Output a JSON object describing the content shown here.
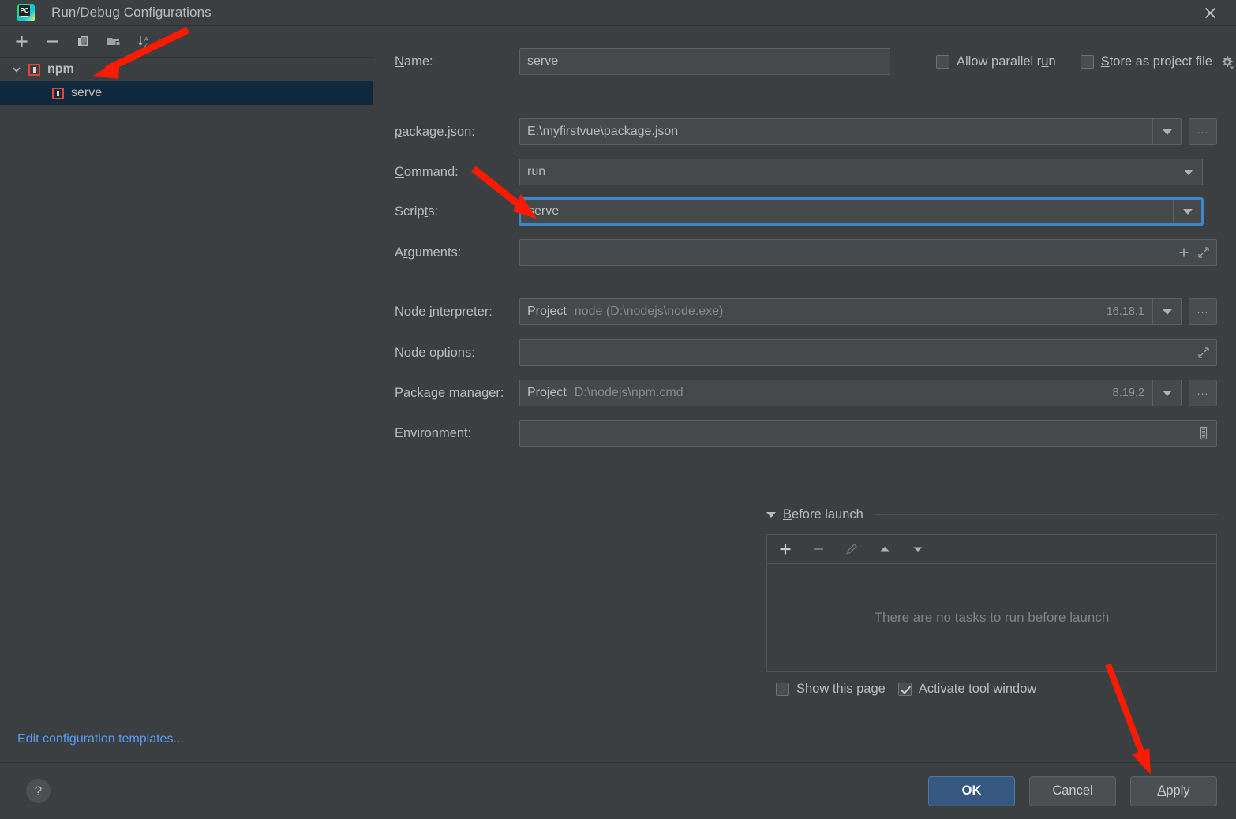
{
  "window": {
    "title": "Run/Debug Configurations",
    "app_icon": "pycharm-logo",
    "close_label": "×"
  },
  "left_panel": {
    "toolbar": [
      {
        "name": "add-configuration-button",
        "glyph": "+"
      },
      {
        "name": "remove-configuration-button",
        "glyph": "−"
      },
      {
        "name": "copy-configuration-button",
        "glyph": "copy-icon"
      },
      {
        "name": "move-into-folder-button",
        "glyph": "folder-icon"
      },
      {
        "name": "sort-configurations-button",
        "glyph": "sort-az-icon"
      }
    ],
    "tree": [
      {
        "name": "tree-group-npm",
        "label": "npm",
        "type": "group",
        "expanded": true,
        "selected": false
      },
      {
        "name": "tree-item-serve",
        "label": "serve",
        "type": "item",
        "selected": true
      }
    ],
    "edit_templates_link": "Edit configuration templates..."
  },
  "form": {
    "name_label": "Name:",
    "name_value": "serve",
    "allow_parallel_run_label": "Allow parallel run",
    "allow_parallel_run_checked": false,
    "store_as_project_file_label": "Store as project file",
    "store_as_project_file_checked": false,
    "gear_icon": "gear-icon",
    "package_json_label": "package.json:",
    "package_json_value": "E:\\myfirstvue\\package.json",
    "command_label": "Command:",
    "command_value": "run",
    "scripts_label": "Scripts:",
    "scripts_value": "serve",
    "arguments_label": "Arguments:",
    "arguments_value": "",
    "node_interpreter_label": "Node interpreter:",
    "node_interpreter_scope": "Project",
    "node_interpreter_value": "node (D:\\nodejs\\node.exe)",
    "node_interpreter_version": "16.18.1",
    "node_options_label": "Node options:",
    "node_options_value": "",
    "package_manager_label": "Package manager:",
    "package_manager_scope": "Project",
    "package_manager_value": "D:\\nodejs\\npm.cmd",
    "package_manager_version": "8.19.2",
    "environment_label": "Environment:",
    "environment_value": "",
    "browse_button_label": "...",
    "expand_icon": "expand-icon",
    "add_icon": "plus-icon",
    "environment_icon": "environment-list-icon"
  },
  "before_launch": {
    "title": "Before launch",
    "expanded": true,
    "toolbar": [
      {
        "name": "add-task-button",
        "glyph": "+"
      },
      {
        "name": "remove-task-button",
        "glyph": "−"
      },
      {
        "name": "edit-task-button",
        "glyph": "pencil-icon"
      },
      {
        "name": "move-task-up-button",
        "glyph": "arrow-up-icon"
      },
      {
        "name": "move-task-down-button",
        "glyph": "arrow-down-icon"
      }
    ],
    "empty_text": "There are no tasks to run before launch",
    "show_this_page_label": "Show this page",
    "show_this_page_checked": false,
    "activate_tool_window_label": "Activate tool window",
    "activate_tool_window_checked": true
  },
  "footer": {
    "help_label": "?",
    "ok_label": "OK",
    "cancel_label": "Cancel",
    "apply_label": "Apply"
  },
  "colors": {
    "background": "#3c3f41",
    "field_background": "#45494a",
    "selection": "#11293d",
    "accent_blue": "#3d86c9",
    "link_blue": "#589df6",
    "primary_button": "#365880",
    "annotation_red": "#fc1a00",
    "npm_icon_red": "#e8443a"
  },
  "annotations": [
    {
      "name": "arrow-to-npm-tree-node",
      "color": "#fc1a00"
    },
    {
      "name": "arrow-to-scripts-field",
      "color": "#fc1a00"
    },
    {
      "name": "arrow-to-apply-button",
      "color": "#fc1a00"
    }
  ]
}
